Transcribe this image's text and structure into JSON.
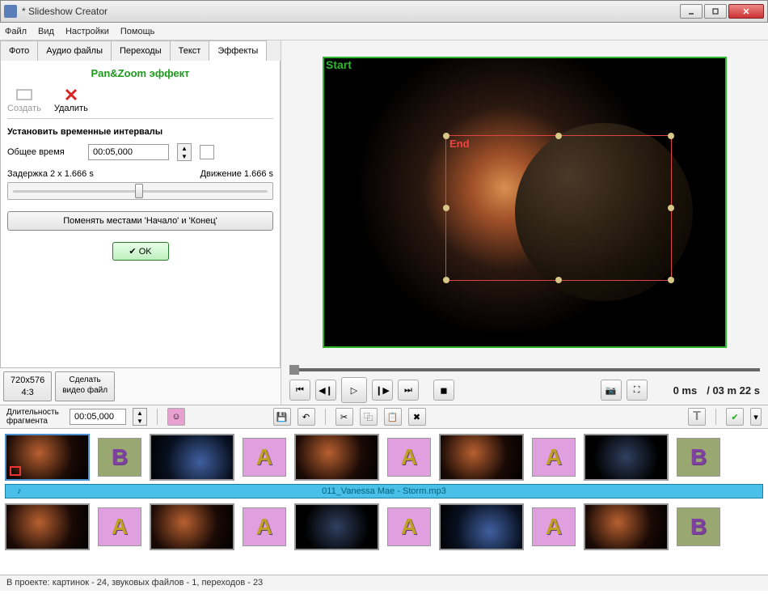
{
  "window": {
    "title": "* Slideshow Creator"
  },
  "menu": {
    "file": "Файл",
    "view": "Вид",
    "settings": "Настройки",
    "help": "Помощь"
  },
  "tabs": {
    "photo": "Фото",
    "audio": "Аудио файлы",
    "transitions": "Переходы",
    "text": "Текст",
    "effects": "Эффекты"
  },
  "panzoom": {
    "header": "Pan&Zoom эффект",
    "create": "Создать",
    "delete": "Удалить",
    "section": "Установить временные интервалы",
    "total_label": "Общее время",
    "total_value": "00:05,000",
    "delay_label": "Задержка 2 x 1.666 s",
    "motion_label": "Движение 1.666 s",
    "swap_btn": "Поменять местами 'Начало' и 'Конец'",
    "ok": "OK"
  },
  "resolution": {
    "size": "720x576",
    "ratio": "4:3"
  },
  "make_video": "Сделать\nвидео файл",
  "preview": {
    "start": "Start",
    "end": "End"
  },
  "playback": {
    "current": "0 ms",
    "total": "/ 03 m 22 s"
  },
  "timeline_header": {
    "frag_label": "Длительность\nфрагмента",
    "frag_value": "00:05,000"
  },
  "audio_track": "011_Vanessa Mae - Storm.mp3",
  "transitions_row1": [
    "B",
    "A",
    "A",
    "A",
    "B"
  ],
  "transitions_row2": [
    "A",
    "A",
    "A",
    "A",
    "B"
  ],
  "status": "В проекте: картинок - 24, звуковых файлов - 1, переходов - 23"
}
